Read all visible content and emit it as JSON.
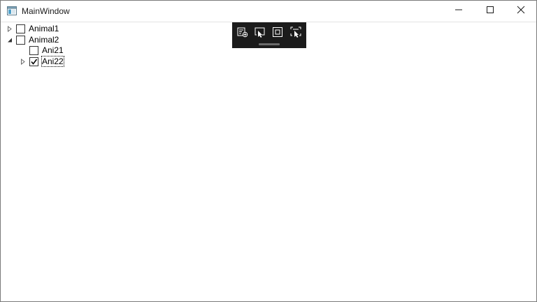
{
  "window": {
    "title": "MainWindow",
    "icon": "app-window-icon",
    "controls": {
      "minimize_icon": "minimize-icon",
      "maximize_icon": "maximize-icon",
      "close_icon": "close-icon"
    }
  },
  "debug_toolbar": {
    "tools": [
      {
        "icon": "go-to-live-visual-tree-icon"
      },
      {
        "icon": "select-element-icon"
      },
      {
        "icon": "display-layout-adorners-icon"
      },
      {
        "icon": "track-focused-element-icon"
      }
    ]
  },
  "tree": {
    "nodes": [
      {
        "label": "Animal1",
        "expanded": false,
        "checked": false,
        "level": 0,
        "has_children": true
      },
      {
        "label": "Animal2",
        "expanded": true,
        "checked": false,
        "level": 0,
        "has_children": true
      },
      {
        "label": "Ani21",
        "expanded": false,
        "checked": false,
        "level": 1,
        "has_children": false
      },
      {
        "label": "Ani22",
        "expanded": false,
        "checked": true,
        "level": 1,
        "has_children": true,
        "focused": true
      }
    ]
  },
  "colors": {
    "toolbar_bg": "#1b1b1b",
    "border": "#7a7a7a",
    "text": "#000000"
  }
}
